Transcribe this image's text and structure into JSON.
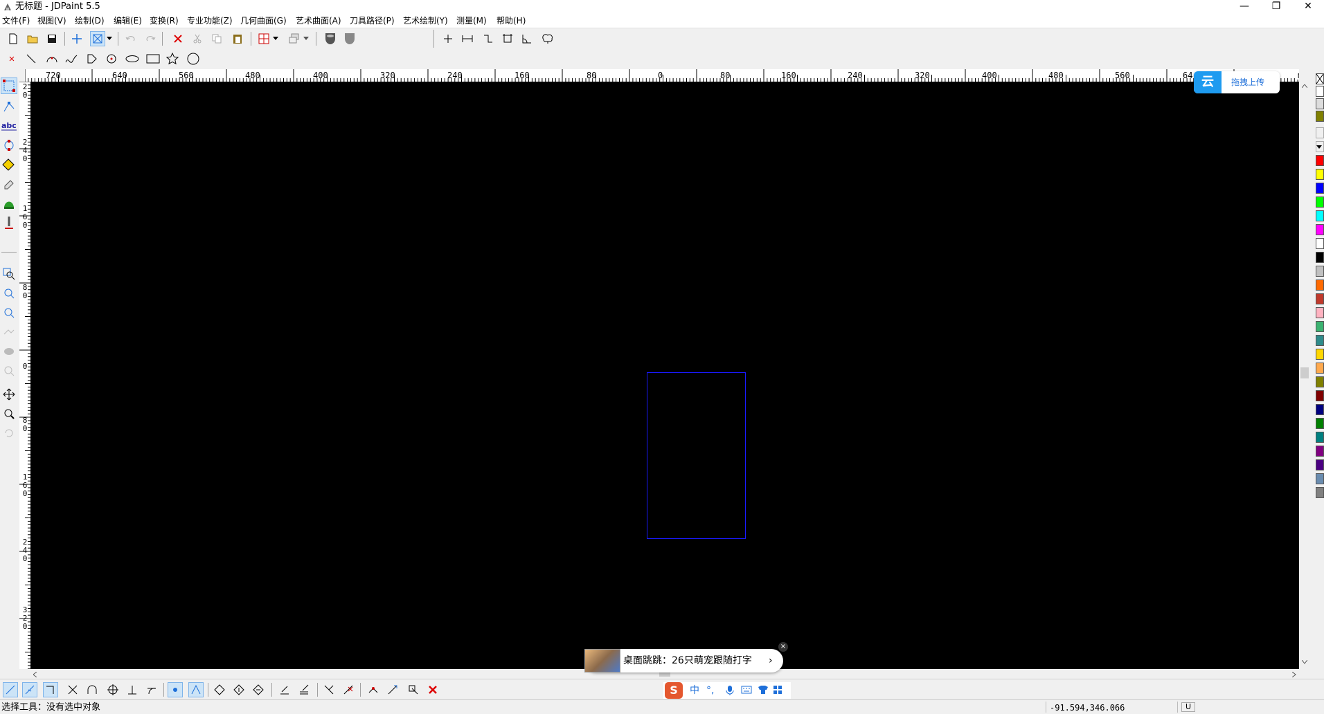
{
  "window": {
    "title": "无标题 - JDPaint 5.5",
    "min_label": "—",
    "max_label": "❐",
    "close_label": "✕"
  },
  "menu": [
    {
      "label": "文件(F)",
      "name": "menu-file"
    },
    {
      "label": "视图(V)",
      "name": "menu-view"
    },
    {
      "label": "绘制(D)",
      "name": "menu-draw"
    },
    {
      "label": "编辑(E)",
      "name": "menu-edit"
    },
    {
      "label": "变换(R)",
      "name": "menu-transform"
    },
    {
      "label": "专业功能(Z)",
      "name": "menu-professional"
    },
    {
      "label": "几何曲面(G)",
      "name": "menu-geometric-surface"
    },
    {
      "label": "艺术曲面(A)",
      "name": "menu-art-surface"
    },
    {
      "label": "刀具路径(P)",
      "name": "menu-toolpath"
    },
    {
      "label": "艺术绘制(Y)",
      "name": "menu-art-draw"
    },
    {
      "label": "测量(M)",
      "name": "menu-measure"
    },
    {
      "label": "帮助(H)",
      "name": "menu-help"
    }
  ],
  "ruler": {
    "unit": "mm",
    "h_labels": [
      "720",
      "640",
      "560",
      "480",
      "400",
      "320",
      "240",
      "160",
      "80",
      "0",
      "80",
      "160",
      "240",
      "320",
      "400",
      "480",
      "560",
      "64"
    ],
    "v_labels": [
      "2",
      "0",
      "2",
      "4",
      "0",
      "1",
      "6",
      "0",
      "8",
      "0",
      "0",
      "8",
      "0",
      "1",
      "6",
      "0",
      "2",
      "4",
      "0",
      "3",
      "2",
      "0"
    ]
  },
  "upload_popup": {
    "logo": "云",
    "label": "拖拽上传"
  },
  "news_popup": {
    "text": "桌面跳跳：26只萌宠跟随打字",
    "arrow": "›",
    "close": "×"
  },
  "ime": {
    "logo": "S",
    "mode": "中",
    "punct": "°,",
    "items": [
      "mic-icon",
      "keyboard-icon",
      "skin-icon",
      "toolbox-icon"
    ]
  },
  "status": {
    "left": "选择工具：没有选中对象",
    "coords": "-91.594,346.066",
    "mode": "U"
  },
  "palette": [
    "#ff0000",
    "#ffff00",
    "#0000ff",
    "#00ff00",
    "#00ffff",
    "#ff00ff",
    "#ffffff",
    "#000000",
    "#c0c0c0",
    "#ff6a00",
    "#c0392b",
    "#ffb3c1",
    "#3cb371",
    "#2e8b8b",
    "#ffd700",
    "#ffa94d",
    "#808000",
    "#800000",
    "#000080",
    "#008000",
    "#008080",
    "#800080",
    "#4b0082",
    "#6a8caf",
    "#808080"
  ],
  "colors": {
    "canvas": "#000000",
    "rect_stroke": "#1a1aff"
  }
}
